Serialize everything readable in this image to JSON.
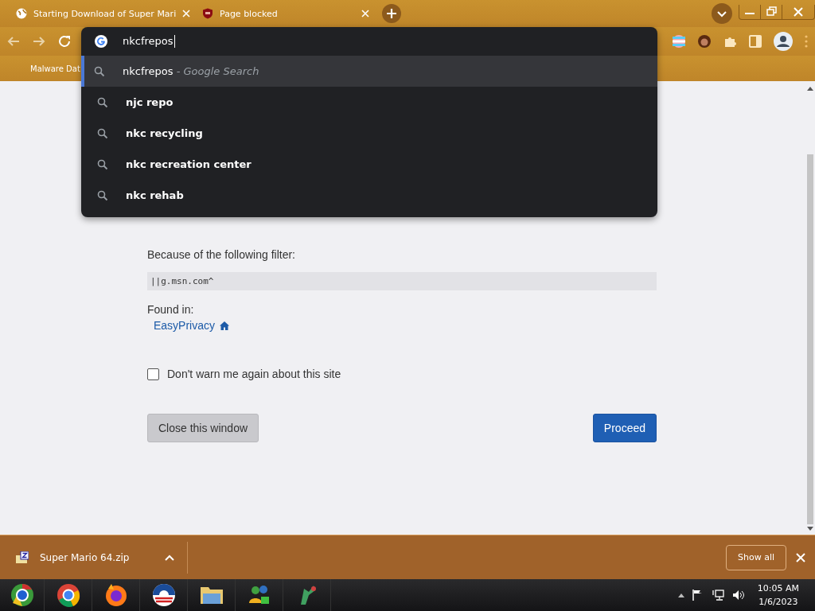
{
  "tabs": [
    {
      "title": "Starting Download of Super Mari"
    },
    {
      "title": "Page blocked"
    }
  ],
  "bookmarks": [
    "Malware Dat"
  ],
  "omnibox": {
    "value": "nkcfrepos",
    "suggestions": [
      {
        "text": "nkcfrepos",
        "hint": "- Google Search",
        "selected": true
      },
      {
        "text": "njc repo",
        "selected": false
      },
      {
        "text": "nkc recycling",
        "selected": false
      },
      {
        "text": "nkc recreation center",
        "selected": false
      },
      {
        "text": "nkc rehab",
        "selected": false
      }
    ]
  },
  "page": {
    "filter_label": "Because of the following filter:",
    "filter": "||g.msn.com^",
    "found_label": "Found in:",
    "found_link": "EasyPrivacy",
    "dont_warn": {
      "label": "Don't warn me again about this site",
      "checked": false
    },
    "buttons": [
      {
        "label": "Close this window",
        "kind": "secondary"
      },
      {
        "label": "Proceed",
        "kind": "primary"
      }
    ]
  },
  "downloads": {
    "items": [
      {
        "name": "Super Mario 64.zip"
      }
    ],
    "show_all": "Show all"
  },
  "taskbar": {
    "time": "10:05 AM",
    "date": "1/6/2023"
  }
}
